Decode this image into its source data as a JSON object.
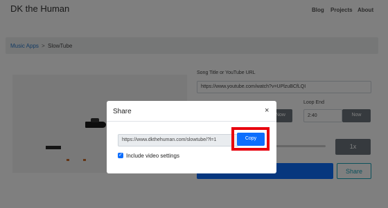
{
  "navbar": {
    "brand": "DK the Human",
    "links": [
      "Blog",
      "Projects",
      "About"
    ]
  },
  "breadcrumb": {
    "parent": "Music Apps",
    "separator": ">",
    "current": "SlowTube"
  },
  "form": {
    "song_label": "Song Title or YouTube URL",
    "song_value": "https://www.youtube.com/watch?v=UPlzuBCfLQI",
    "loop_start_now": "Now",
    "loop_end_label": "Loop End",
    "loop_end_value": "2:40",
    "loop_end_now": "Now",
    "speed": "1x",
    "share": "Share"
  },
  "modal": {
    "title": "Share",
    "close": "×",
    "share_url": "https://www.dkthehuman.com/slowtube/?l=1",
    "copy": "Copy",
    "checkbox_mark": "✓",
    "include_label": "Include video settings"
  },
  "colors": {
    "primary": "#0d6efd",
    "secondary": "#6c757d",
    "highlight": "#e8000d",
    "info": "#17a2b8"
  }
}
